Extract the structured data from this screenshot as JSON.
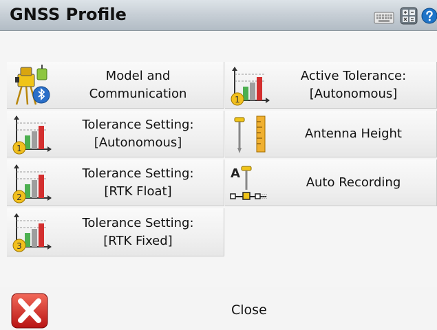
{
  "window": {
    "title": "GNSS Profile"
  },
  "toolbar": {
    "keyboard_icon": "keyboard-icon",
    "calculator_icon": "calculator-icon",
    "help_icon": "help-icon"
  },
  "menu": {
    "model_communication": {
      "label": "Model and\nCommunication",
      "icon": "instrument-bluetooth-icon"
    },
    "active_tolerance": {
      "label": "Active Tolerance:\n[Autonomous]",
      "icon": "tolerance-chart-1-icon"
    },
    "tolerance_autonomous": {
      "label": "Tolerance Setting:\n[Autonomous]",
      "icon": "tolerance-chart-1-icon"
    },
    "antenna_height": {
      "label": "Antenna Height",
      "icon": "antenna-height-icon"
    },
    "tolerance_rtk_float": {
      "label": "Tolerance Setting:\n[RTK Float]",
      "icon": "tolerance-chart-2-icon"
    },
    "auto_recording": {
      "label": "Auto Recording",
      "icon": "auto-recording-icon"
    },
    "tolerance_rtk_fixed": {
      "label": "Tolerance Setting:\n[RTK Fixed]",
      "icon": "tolerance-chart-3-icon"
    }
  },
  "footer": {
    "close_label": "Close",
    "close_icon": "close-x-icon"
  },
  "colors": {
    "title_gradient_top": "#dde3e8",
    "title_gradient_bottom": "#b2bcc5",
    "close_red": "#d42020",
    "badge_yellow": "#f2c01e"
  }
}
